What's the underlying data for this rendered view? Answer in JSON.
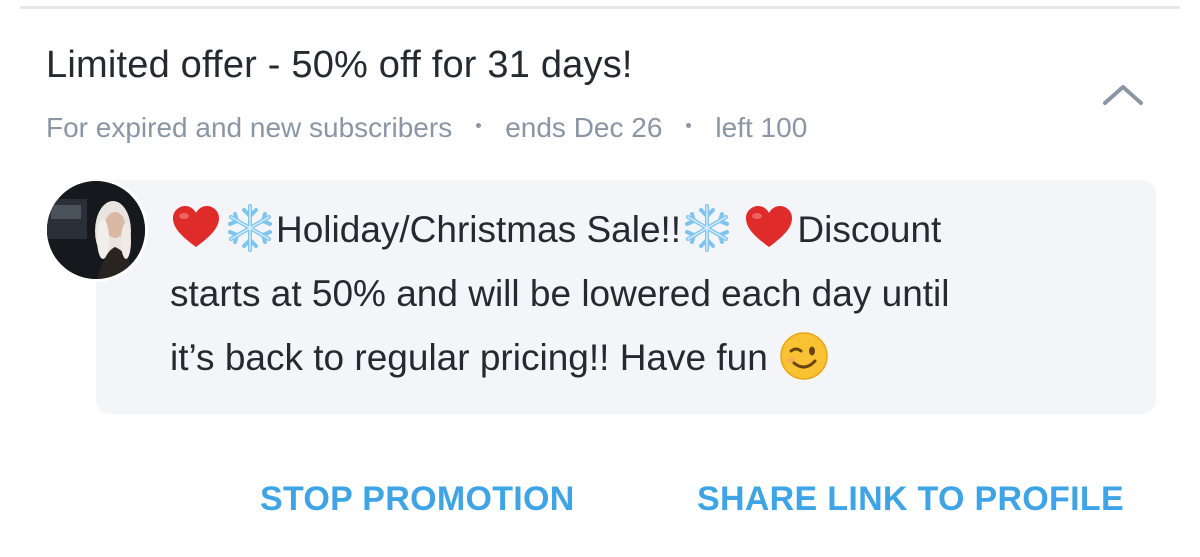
{
  "promotion": {
    "title": "Limited offer - 50% off for 31 days!",
    "audience": "For expired and new subscribers",
    "ends": "ends Dec 26",
    "left": "left 100",
    "message": {
      "line1_part1": "Holiday/Christmas Sale!!",
      "line1_part2": "Discount",
      "line2": "starts at 50% and will be lowered each day until",
      "line3": "it’s back to regular pricing!! Have fun"
    },
    "icons": {
      "collapse": "chevron-up-icon",
      "heart": "red-heart-emoji",
      "snowflake": "snowflake-emoji",
      "wink": "winking-face-emoji"
    }
  },
  "actions": {
    "stop_label": "STOP PROMOTION",
    "share_label": "SHARE LINK TO PROFILE"
  },
  "colors": {
    "accent": "#3ea4e6",
    "muted": "#8a96a3",
    "text": "#242a30",
    "bubble": "#f4f5f8"
  }
}
